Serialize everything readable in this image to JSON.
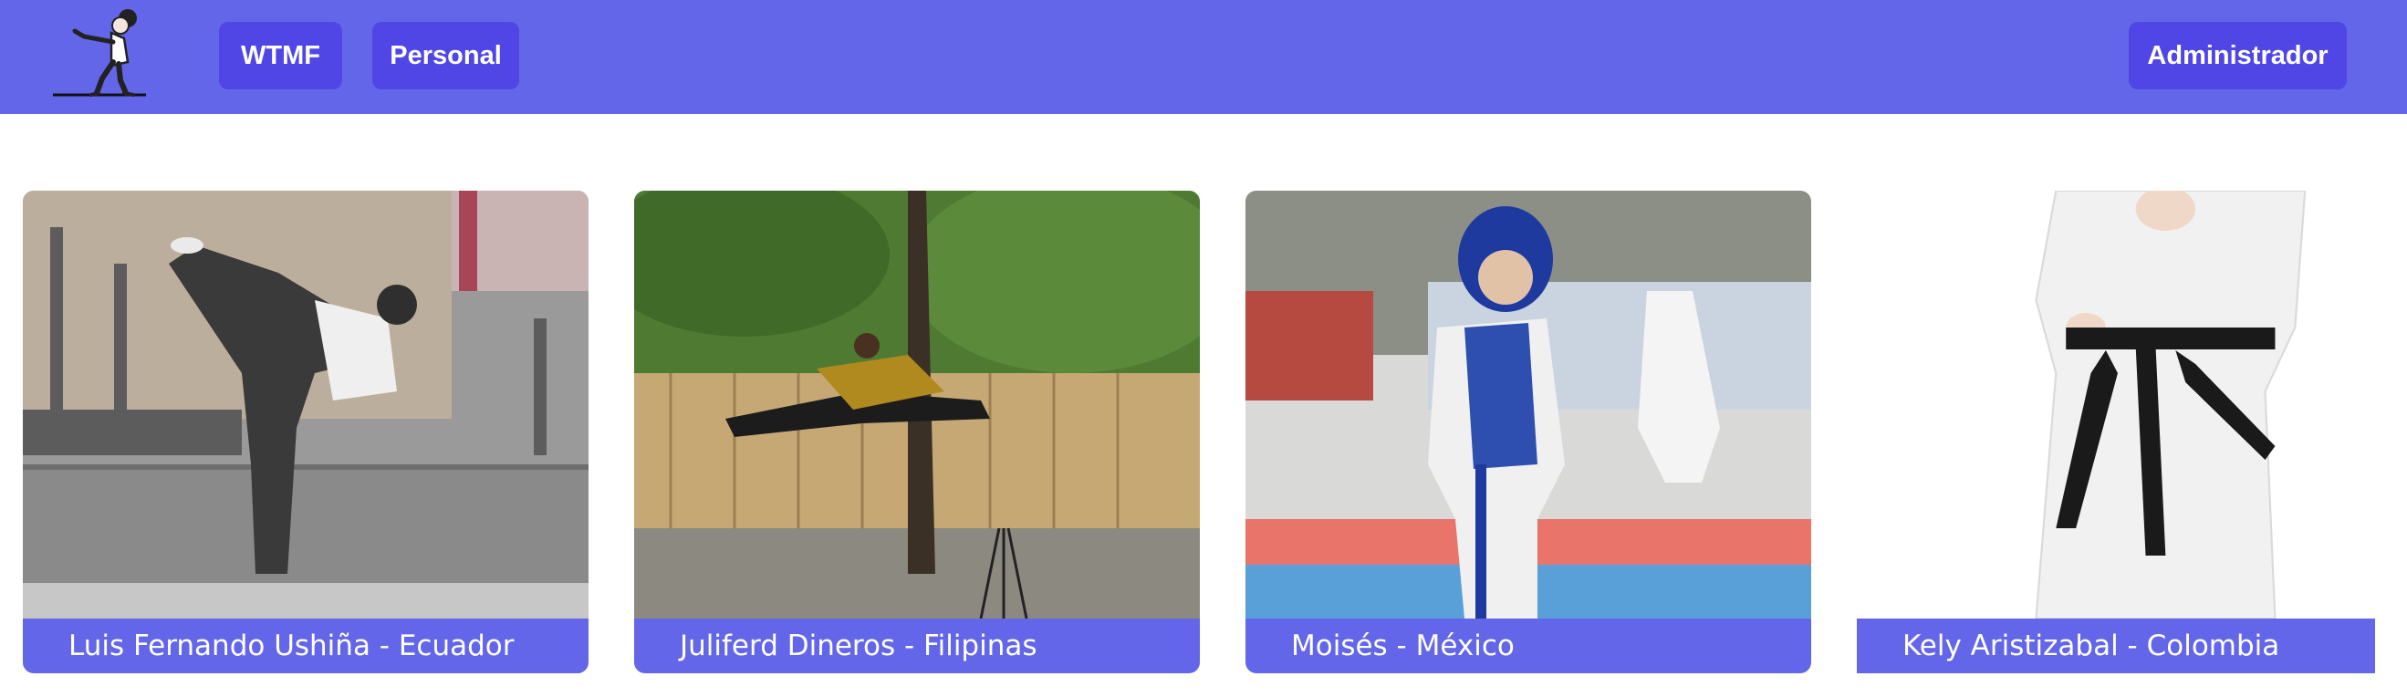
{
  "navbar": {
    "logo_icon": "karate-kick-logo-icon",
    "links": [
      {
        "label": "WTMF"
      },
      {
        "label": "Personal"
      }
    ],
    "admin_label": "Administrador",
    "colors": {
      "bar": "#6366e8",
      "button": "#4f46e5",
      "text": "#ffffff"
    }
  },
  "cards": [
    {
      "caption": "Luis Fernando Ushiña - Ecuador",
      "image": "grayscale-martial-artist-high-kick-trophies-photo"
    },
    {
      "caption": "Juliferd Dineros - Filipinas",
      "image": "flying-split-kick-in-yard-photo"
    },
    {
      "caption": "Moisés - México",
      "image": "child-taekwondo-competitor-photo"
    },
    {
      "caption": "Kely Aristizabal - Colombia",
      "image": "white-uniform-black-belt-stock-photo"
    }
  ]
}
